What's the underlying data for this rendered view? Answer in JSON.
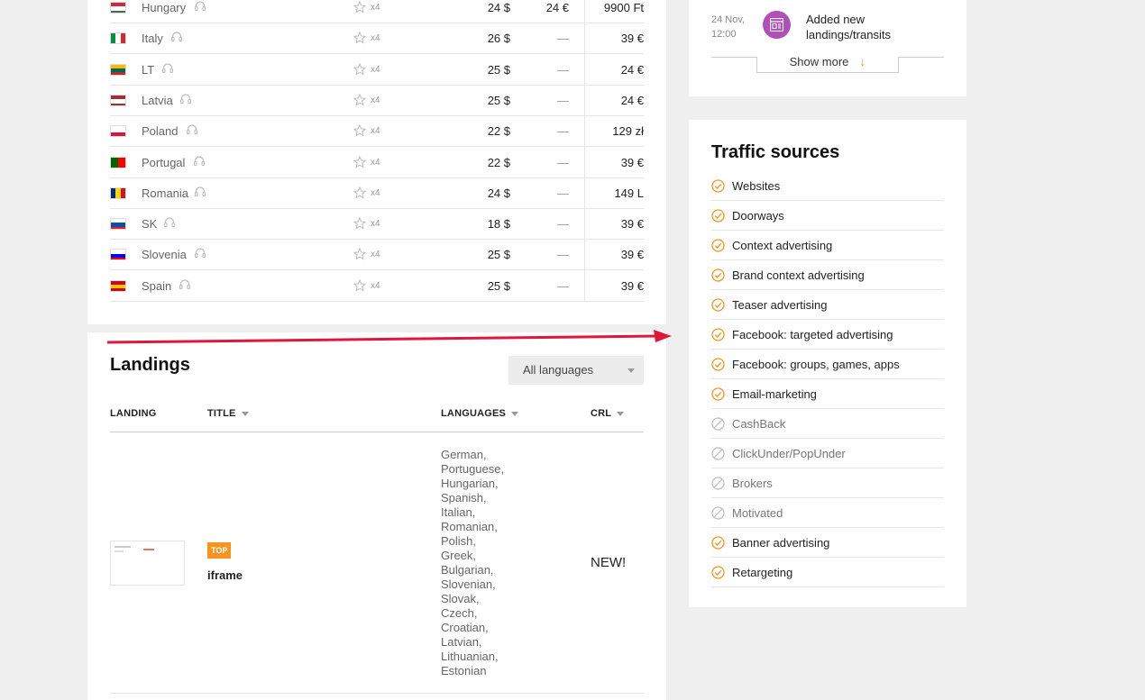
{
  "countries": [
    {
      "name": "Hungary",
      "mult": "x4",
      "price1": "24 $",
      "price2": "24 €",
      "price3": "9900 Ft",
      "flag": [
        "#cd2a3e",
        "#ffffff",
        "#436f4d"
      ],
      "flag_dir": "h"
    },
    {
      "name": "Italy",
      "mult": "x4",
      "price1": "26 $",
      "price2": "—",
      "price3": "39 €",
      "flag": [
        "#009246",
        "#ffffff",
        "#ce2b37"
      ],
      "flag_dir": "v"
    },
    {
      "name": "LT",
      "mult": "x4",
      "price1": "25 $",
      "price2": "—",
      "price3": "24 €",
      "flag": [
        "#fdb913",
        "#006a44",
        "#c1272d"
      ],
      "flag_dir": "h"
    },
    {
      "name": "Latvia",
      "mult": "x4",
      "price1": "25 $",
      "price2": "—",
      "price3": "24 €",
      "flag": [
        "#9e3039",
        "#ffffff",
        "#9e3039"
      ],
      "flag_dir": "h"
    },
    {
      "name": "Poland",
      "mult": "x4",
      "price1": "22 $",
      "price2": "—",
      "price3": "129 zł",
      "flag": [
        "#ffffff",
        "#dc143c"
      ],
      "flag_dir": "h"
    },
    {
      "name": "Portugal",
      "mult": "x4",
      "price1": "22 $",
      "price2": "—",
      "price3": "39 €",
      "flag": [
        "#006600",
        "#ff0000"
      ],
      "flag_dir": "v"
    },
    {
      "name": "Romania",
      "mult": "x4",
      "price1": "24 $",
      "price2": "—",
      "price3": "149 L",
      "flag": [
        "#002b7f",
        "#fcd116",
        "#ce1126"
      ],
      "flag_dir": "v"
    },
    {
      "name": "SK",
      "mult": "x4",
      "price1": "18 $",
      "price2": "—",
      "price3": "39 €",
      "flag": [
        "#ffffff",
        "#0b4ea2",
        "#ee1c25"
      ],
      "flag_dir": "h"
    },
    {
      "name": "Slovenia",
      "mult": "x4",
      "price1": "25 $",
      "price2": "—",
      "price3": "39 €",
      "flag": [
        "#ffffff",
        "#0000ff",
        "#ff0000"
      ],
      "flag_dir": "h"
    },
    {
      "name": "Spain",
      "mult": "x4",
      "price1": "25 $",
      "price2": "—",
      "price3": "39 €",
      "flag": [
        "#c60b1e",
        "#ffc400",
        "#c60b1e"
      ],
      "flag_dir": "h"
    }
  ],
  "landings": {
    "title": "Landings",
    "language_select": "All languages",
    "columns": {
      "landing": "LANDING",
      "title": "TITLE",
      "languages": "LANGUAGES",
      "crl": "CRL"
    },
    "row": {
      "badge": "TOP",
      "name": "iframe",
      "languages": [
        "German,",
        "Portuguese,",
        "Hungarian,",
        "Spanish,",
        "Italian,",
        "Romanian,",
        "Polish,",
        "Greek,",
        "Bulgarian,",
        "Slovenian,",
        "Slovak,",
        "Czech,",
        "Croatian,",
        "Latvian,",
        "Lithuanian,",
        "Estonian"
      ],
      "crl": "NEW!"
    }
  },
  "news": {
    "date": "24 Nov,",
    "time": "12:00",
    "text": "Added new landings/transits",
    "show_more": "Show more"
  },
  "traffic": {
    "title": "Traffic sources",
    "items": [
      {
        "label": "Websites",
        "allowed": true
      },
      {
        "label": "Doorways",
        "allowed": true
      },
      {
        "label": "Context advertising",
        "allowed": true
      },
      {
        "label": "Brand context advertising",
        "allowed": true
      },
      {
        "label": "Teaser advertising",
        "allowed": true
      },
      {
        "label": "Facebook: targeted advertising",
        "allowed": true
      },
      {
        "label": "Facebook: groups, games, apps",
        "allowed": true
      },
      {
        "label": "Email-marketing",
        "allowed": true
      },
      {
        "label": "CashBack",
        "allowed": false
      },
      {
        "label": "ClickUnder/PopUnder",
        "allowed": false
      },
      {
        "label": "Brokers",
        "allowed": false
      },
      {
        "label": "Motivated",
        "allowed": false
      },
      {
        "label": "Banner advertising",
        "allowed": true
      },
      {
        "label": "Retargeting",
        "allowed": true
      }
    ]
  },
  "colors": {
    "accent": "#f7931e",
    "news_icon": "#b04fb8",
    "arrow": "#e0173a"
  }
}
